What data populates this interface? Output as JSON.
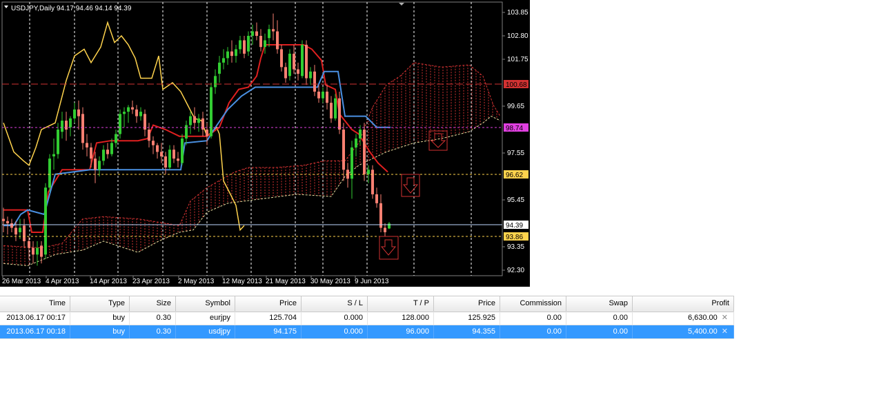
{
  "chart": {
    "title": "USDJPY,Daily  94.17 94.46 94.14 94.39",
    "price_scale": [
      "103.85",
      "102.80",
      "101.75",
      "99.65",
      "97.55",
      "95.45",
      "93.35",
      "92.30"
    ],
    "date_labels": [
      "26 Mar 2013",
      "4 Apr 2013",
      "14 Apr 2013",
      "23 Apr 2013",
      "2 May 2013",
      "12 May 2013",
      "21 May 2013",
      "30 May 2013",
      "9 Jun 2013"
    ],
    "level_tags": {
      "red": "100.68",
      "magenta": "98.74",
      "yellow": "96.62",
      "current": "94.39",
      "low": "93.86"
    },
    "colors": {
      "background": "#000000",
      "bull": "#32cd32",
      "bear": "#fa8072",
      "tenkan": "#e02020",
      "kijun": "#4a90e2",
      "chikou": "#ffd34d",
      "cloud": "#d23232"
    },
    "arrow_icon": "down-arrow-icon"
  },
  "trades": {
    "columns": [
      "Time",
      "Type",
      "Size",
      "Symbol",
      "Price",
      "S / L",
      "T / P",
      "Price",
      "Commission",
      "Swap",
      "Profit"
    ],
    "rows": [
      {
        "time": "2013.06.17 00:17",
        "type": "buy",
        "size": "0.30",
        "symbol": "eurjpy",
        "price": "125.704",
        "sl": "0.000",
        "tp": "128.000",
        "cur_price": "125.925",
        "commission": "0.00",
        "swap": "0.00",
        "profit": "6,630.00"
      },
      {
        "time": "2013.06.17 00:18",
        "type": "buy",
        "size": "0.30",
        "symbol": "usdjpy",
        "price": "94.175",
        "sl": "0.000",
        "tp": "96.000",
        "cur_price": "94.355",
        "commission": "0.00",
        "swap": "0.00",
        "profit": "5,400.00"
      }
    ],
    "close_icon": "close-icon"
  }
}
